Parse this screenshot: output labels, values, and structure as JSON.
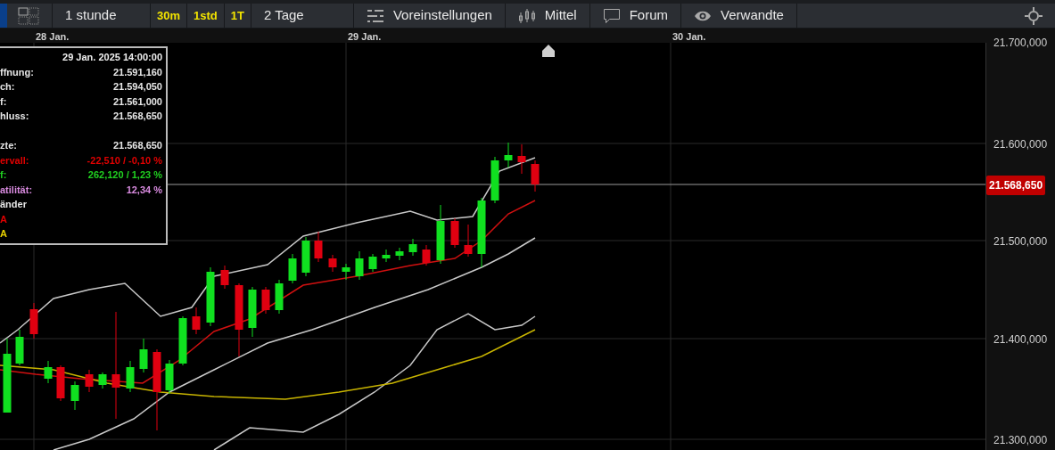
{
  "toolbar": {
    "items": [
      {
        "kind": "icon"
      },
      {
        "kind": "button",
        "label": "1 stunde"
      },
      {
        "kind": "interval",
        "label": "30m"
      },
      {
        "kind": "interval",
        "label": "1std"
      },
      {
        "kind": "interval",
        "label": "1T"
      },
      {
        "kind": "button",
        "label": "2 Tage"
      },
      {
        "kind": "button",
        "label": "Voreinstellungen"
      },
      {
        "kind": "button",
        "label": "Mittel"
      },
      {
        "kind": "button",
        "label": "Forum"
      },
      {
        "kind": "button",
        "label": "Verwandte"
      }
    ]
  },
  "date_axis": [
    "28 Jan.",
    "29 Jan.",
    "30 Jan."
  ],
  "price_axis": [
    "21.700,000",
    "21.600,000",
    "21.500,000",
    "21.400,000",
    "21.300,000"
  ],
  "last_price": "21.568,650",
  "tooltip": {
    "title": "29 Jan. 2025 14:00:00",
    "rows": [
      {
        "kind": "row",
        "label": "ffnung:",
        "value": "21.591,160",
        "color": "#e6e6e6"
      },
      {
        "kind": "row",
        "label": "ch:",
        "value": "21.594,050",
        "color": "#e6e6e6"
      },
      {
        "kind": "row",
        "label": "f:",
        "value": "21.561,000",
        "color": "#e6e6e6"
      },
      {
        "kind": "row",
        "label": "hluss:",
        "value": "21.568,650",
        "color": "#e6e6e6"
      },
      {
        "kind": "gap"
      },
      {
        "kind": "row",
        "label": "zte:",
        "value": "21.568,650",
        "color": "#e6e6e6"
      },
      {
        "kind": "row",
        "label": "ervall:",
        "value": "-22,510 / -0,10 %",
        "color": "#e00000"
      },
      {
        "kind": "row",
        "label": "f:",
        "value": "262,120 / 1,23 %",
        "color": "#20d020"
      },
      {
        "kind": "row",
        "label": "atilität:",
        "value": "12,34 %",
        "color": "#d98be0"
      },
      {
        "kind": "row",
        "label": "änder",
        "color": "#e6e6e6"
      },
      {
        "kind": "row",
        "label": "A",
        "color": "#e00000"
      },
      {
        "kind": "row",
        "label": "A",
        "color": "#e6d000"
      }
    ]
  }
}
